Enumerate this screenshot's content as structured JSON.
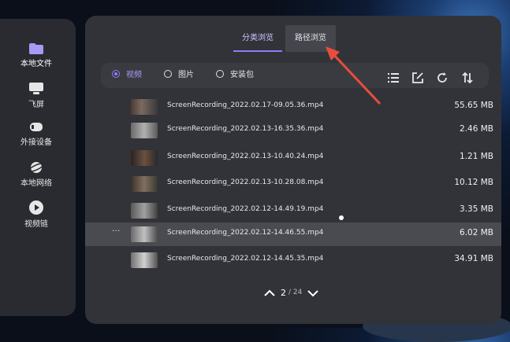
{
  "sidebar": {
    "items": [
      {
        "label": "本地文件",
        "icon": "folder-icon",
        "active": true
      },
      {
        "label": "飞屏",
        "icon": "monitor-icon"
      },
      {
        "label": "外接设备",
        "icon": "external-device-icon"
      },
      {
        "label": "本地网络",
        "icon": "planet-icon"
      },
      {
        "label": "视频链",
        "icon": "play-icon"
      }
    ]
  },
  "tabs": [
    {
      "label": "分类浏览",
      "active": true
    },
    {
      "label": "路径浏览",
      "active": false
    }
  ],
  "filters": [
    {
      "label": "视频",
      "selected": true
    },
    {
      "label": "图片",
      "selected": false
    },
    {
      "label": "安装包",
      "selected": false
    }
  ],
  "toolbar": [
    "list-icon",
    "edit-icon",
    "refresh-icon",
    "sort-icon"
  ],
  "files": [
    {
      "name": "ScreenRecording_2022.02.17-09.05.36.mp4",
      "size": "55.65 MB"
    },
    {
      "name": "ScreenRecording_2022.02.13-16.35.36.mp4",
      "size": "2.46 MB"
    },
    {
      "name": "ScreenRecording_2022.02.13-10.40.24.mp4",
      "size": "1.21 MB"
    },
    {
      "name": "ScreenRecording_2022.02.13-10.28.08.mp4",
      "size": "10.12 MB"
    },
    {
      "name": "ScreenRecording_2022.02.12-14.49.19.mp4",
      "size": "3.35 MB"
    },
    {
      "name": "ScreenRecording_2022.02.12-14.46.55.mp4",
      "size": "6.02 MB",
      "more": "···"
    },
    {
      "name": "ScreenRecording_2022.02.12-14.45.35.mp4",
      "size": "34.91 MB"
    }
  ],
  "pager": {
    "current": "2",
    "total": "/ 24"
  },
  "colors": {
    "accent": "#8e7cf6",
    "annotation": "#e84d3c"
  }
}
